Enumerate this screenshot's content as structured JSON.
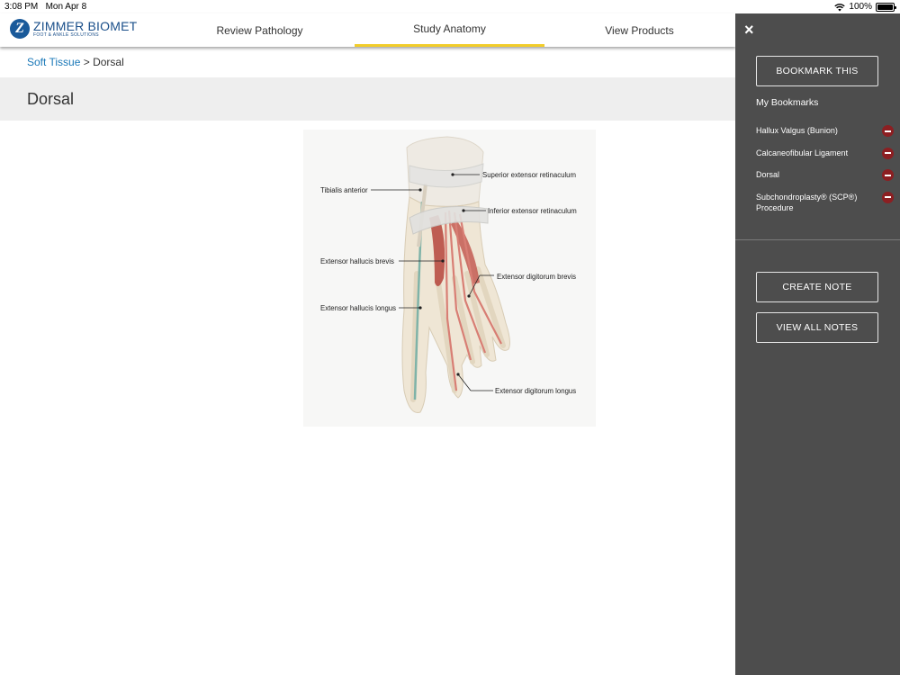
{
  "status": {
    "time": "3:08 PM",
    "date": "Mon Apr 8",
    "battery": "100%",
    "battery_level": 1.0
  },
  "brand": {
    "mark": "Z",
    "name": "ZIMMER BIOMET",
    "sub": "FOOT & ANKLE SOLUTIONS"
  },
  "nav": {
    "tabs": [
      {
        "label": "Review Pathology"
      },
      {
        "label": "Study Anatomy",
        "active": true
      },
      {
        "label": "View Products"
      }
    ]
  },
  "breadcrumb": {
    "parent": "Soft Tissue",
    "separator": ">",
    "current": "Dorsal"
  },
  "page": {
    "title": "Dorsal"
  },
  "figure": {
    "labels": {
      "tibialis_anterior": "Tibialis anterior",
      "superior_extensor_retinaculum": "Superior extensor retinaculum",
      "inferior_extensor_retinaculum": "Inferior extensor retinaculum",
      "extensor_hallucis_brevis": "Extensor hallucis brevis",
      "extensor_digitorum_brevis": "Extensor digitorum brevis",
      "extensor_hallucis_longus": "Extensor hallucis longus",
      "extensor_digitorum_longus": "Extensor digitorum longus"
    }
  },
  "panel": {
    "close_icon": "×",
    "bookmark_button": "BOOKMARK THIS",
    "bookmarks_heading": "My Bookmarks",
    "bookmarks": [
      {
        "label": "Hallux Valgus (Bunion)"
      },
      {
        "label": "Calcaneofibular Ligament"
      },
      {
        "label": "Dorsal"
      },
      {
        "label": "Subchondroplasty® (SCP®) Procedure"
      }
    ],
    "create_note_button": "CREATE NOTE",
    "view_notes_button": "VIEW ALL NOTES"
  },
  "colors": {
    "accent": "#f2cd2a",
    "link": "#1a78b8",
    "panel_bg": "#4d4d4d",
    "remove": "#8c1f22",
    "brand": "#1a5a9a"
  }
}
